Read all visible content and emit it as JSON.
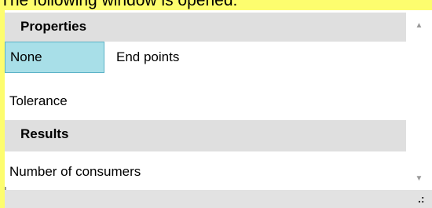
{
  "caption": "The following window is opened:",
  "properties_panel": {
    "header_properties": "Properties",
    "value_none": "None",
    "value_end_points": "End points",
    "label_tolerance": "Tolerance",
    "header_results": "Results",
    "label_number_of_consumers": "Number of consumers"
  },
  "scrollbar": {
    "up_icon": "triangle-up-icon",
    "down_icon": "triangle-down-icon",
    "up_glyph": "▲",
    "down_glyph": "▼"
  },
  "status_bar": {
    "grip_icon": "resize-grip-icon",
    "grip_glyph": ".:"
  },
  "colors": {
    "highlight_background": "#fdfd6e",
    "section_header": "#dfdfdf",
    "selected_cell": "#a8dfe8",
    "selected_border": "#5bb2c7"
  }
}
